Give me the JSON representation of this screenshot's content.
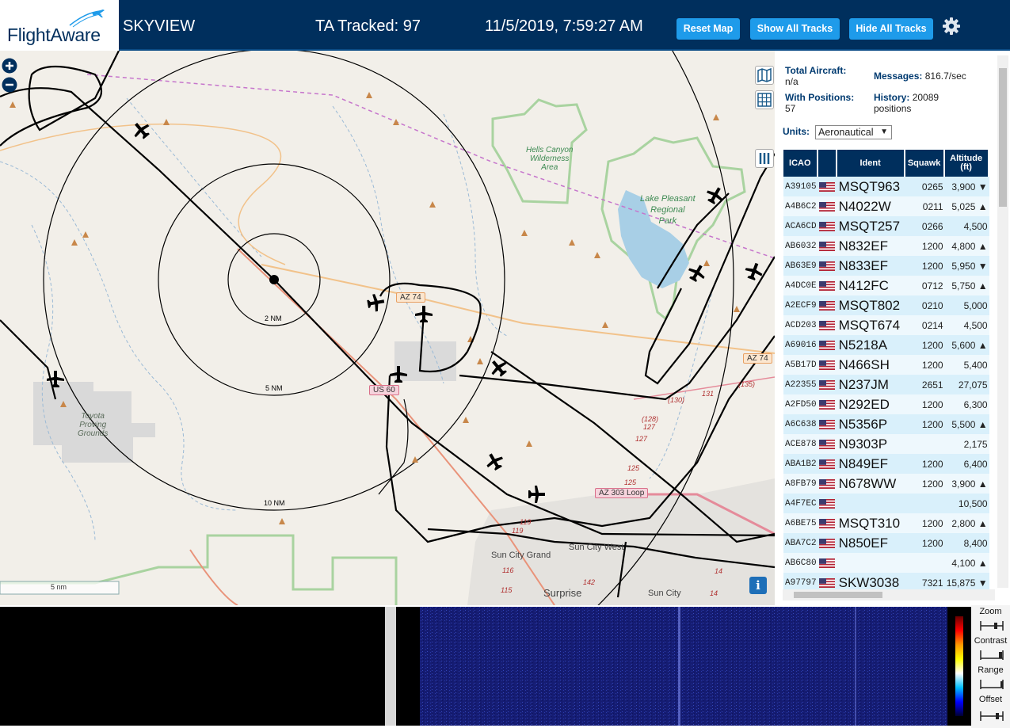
{
  "header": {
    "logo_text": "FlightAware",
    "app_title": "SKYVIEW",
    "tracked_label": "TA Tracked: 97",
    "clock": "11/5/2019, 7:59:27 AM",
    "buttons": {
      "reset": "Reset Map",
      "show": "Show All Tracks",
      "hide": "Hide All Tracks"
    },
    "settings_icon": "gear-icon"
  },
  "map": {
    "zoom_in": "+",
    "zoom_out": "−",
    "ring_labels": [
      "2 NM",
      "5 NM",
      "10 NM"
    ],
    "scale_label": "5 nm",
    "places": {
      "hells_canyon": [
        "Hells Canyon",
        "Wilderness",
        "Area"
      ],
      "lake_pleasant": [
        "Lake Pleasant",
        "Regional",
        "Park"
      ],
      "toyota": [
        "Toyota",
        "Proving",
        "Grounds"
      ],
      "sun_city_grand": "Sun City Grand",
      "sun_city_west": "Sun City West",
      "surprise": "Surprise",
      "sun_city": "Sun City"
    },
    "shields": {
      "az74": "AZ 74",
      "az74_east": "AZ 74",
      "us60": "US 60",
      "az303": "AZ 303 Loop"
    },
    "route_numbers": [
      "(128)",
      "127",
      "127",
      "(130)",
      "131",
      "(135)",
      "125",
      "125",
      "119",
      "119",
      "116",
      "115",
      "142",
      "14",
      "14"
    ],
    "info_icon": "i"
  },
  "sidebar": {
    "total_aircraft_label": "Total Aircraft:",
    "total_aircraft_value": "n/a",
    "with_positions_label": "With Positions:",
    "with_positions_value": "57",
    "messages_label": "Messages:",
    "messages_value": "816.7/sec",
    "history_label": "History:",
    "history_value": "20089",
    "history_unit": "positions",
    "units_label": "Units:",
    "units_value": "Aeronautical",
    "columns": [
      "ICAO",
      "",
      "Ident",
      "Squawk",
      "Altitude (ft)"
    ],
    "rows": [
      {
        "icao": "A39105",
        "ident": "MSQT963",
        "squawk": "0265",
        "alt": "3,900 ▼"
      },
      {
        "icao": "A4B6C2",
        "ident": "N4022W",
        "squawk": "0211",
        "alt": "5,025 ▲"
      },
      {
        "icao": "ACA6CD",
        "ident": "MSQT257",
        "squawk": "0266",
        "alt": "4,500"
      },
      {
        "icao": "AB6032",
        "ident": "N832EF",
        "squawk": "1200",
        "alt": "4,800 ▲"
      },
      {
        "icao": "AB63E9",
        "ident": "N833EF",
        "squawk": "1200",
        "alt": "5,950 ▼"
      },
      {
        "icao": "A4DC0E",
        "ident": "N412FC",
        "squawk": "0712",
        "alt": "5,750 ▲"
      },
      {
        "icao": "A2ECF9",
        "ident": "MSQT802",
        "squawk": "0210",
        "alt": "5,000"
      },
      {
        "icao": "ACD203",
        "ident": "MSQT674",
        "squawk": "0214",
        "alt": "4,500"
      },
      {
        "icao": "A69016",
        "ident": "N5218A",
        "squawk": "1200",
        "alt": "5,600 ▲"
      },
      {
        "icao": "A5B17D",
        "ident": "N466SH",
        "squawk": "1200",
        "alt": "5,400"
      },
      {
        "icao": "A22355",
        "ident": "N237JM",
        "squawk": "2651",
        "alt": "27,075"
      },
      {
        "icao": "A2FD50",
        "ident": "N292ED",
        "squawk": "1200",
        "alt": "6,300"
      },
      {
        "icao": "A6C638",
        "ident": "N5356P",
        "squawk": "1200",
        "alt": "5,500 ▲"
      },
      {
        "icao": "ACE878",
        "ident": "N9303P",
        "squawk": "",
        "alt": "2,175"
      },
      {
        "icao": "ABA1B2",
        "ident": "N849EF",
        "squawk": "1200",
        "alt": "6,400"
      },
      {
        "icao": "A8FB79",
        "ident": "N678WW",
        "squawk": "1200",
        "alt": "3,900 ▲"
      },
      {
        "icao": "A4F7EC",
        "ident": "",
        "squawk": "",
        "alt": "10,500"
      },
      {
        "icao": "A6BE75",
        "ident": "MSQT310",
        "squawk": "1200",
        "alt": "2,800 ▲"
      },
      {
        "icao": "ABA7C2",
        "ident": "N850EF",
        "squawk": "1200",
        "alt": "8,400"
      },
      {
        "icao": "AB6C80",
        "ident": "",
        "squawk": "",
        "alt": "4,100 ▲"
      },
      {
        "icao": "A97797",
        "ident": "SKW3038",
        "squawk": "7321",
        "alt": "15,875 ▼"
      }
    ]
  },
  "spectrum_controls": {
    "zoom": "Zoom",
    "contrast": "Contrast",
    "range": "Range",
    "offset": "Offset"
  },
  "colors": {
    "header_bg": "#002f5d",
    "button_bg": "#1e9bea",
    "map_bg": "#f2efe9",
    "row_bg": "#d9f0fb",
    "spectrum_bg": "#141a6e"
  }
}
